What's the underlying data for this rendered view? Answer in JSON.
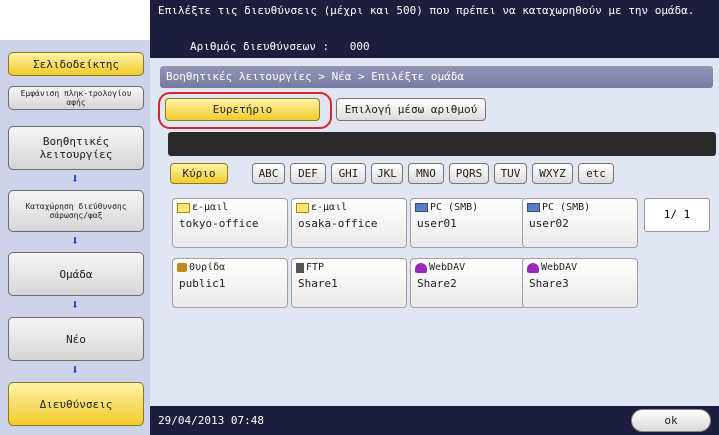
{
  "header": {
    "message": "Επιλέξτε τις διευθύνσεις (μέχρι και 500) που πρέπει να καταχωρηθούν με την ομάδα.",
    "count_label": "Αριθμός διευθύνσεων :",
    "count_value": "000"
  },
  "sidebar": {
    "bookmark": "Σελιδοδείκτης",
    "show_keypad": "Εμφάνιση πληκ-τρολογίου αφής",
    "steps": [
      "Βοηθητικές λειτουργίες",
      "Καταχώρηση διεύθυνσης σάρωσης/φαξ",
      "Ομάδα",
      "Νέο",
      "Διευθύνσεις"
    ]
  },
  "main": {
    "breadcrumb": "Βοηθητικές λειτουργίες > Νέα > Επιλέξτε ομάδα",
    "tabs": [
      "Ευρετήριο",
      "Επιλογή μέσω αριθμού"
    ],
    "index_keys": [
      "Κύριο",
      "ABC",
      "DEF",
      "GHI",
      "JKL",
      "MNO",
      "PQRS",
      "TUV",
      "WXYZ",
      "etc"
    ],
    "destinations": [
      {
        "type": "ε-μαιl",
        "icon": "mail-icon",
        "name": "tokyo-office"
      },
      {
        "type": "ε-μαιl",
        "icon": "mail-icon",
        "name": "osaka-office"
      },
      {
        "type": "PC (SMB)",
        "icon": "pc-icon",
        "name": "user01"
      },
      {
        "type": "PC (SMB)",
        "icon": "pc-icon",
        "name": "user02"
      },
      {
        "type": "Θυρίδα",
        "icon": "box-icon",
        "name": "public1"
      },
      {
        "type": "FTP",
        "icon": "ftp-icon",
        "name": "Share1"
      },
      {
        "type": "WebDAV",
        "icon": "webdav-icon",
        "name": "Share2"
      },
      {
        "type": "WebDAV",
        "icon": "webdav-icon",
        "name": "Share3"
      }
    ],
    "page_indicator": "1/  1"
  },
  "footer": {
    "datetime": "29/04/2013   07:48",
    "ok_label": "ok"
  },
  "colors": {
    "dark_bar": "#1d1d3e",
    "sidebar_bg": "#cfd3ea",
    "panel_bg": "#e2e6f3",
    "active_yellow": "#f2cb2a",
    "highlight_red": "#d8262b",
    "arrow_blue": "#1a3ccf"
  }
}
